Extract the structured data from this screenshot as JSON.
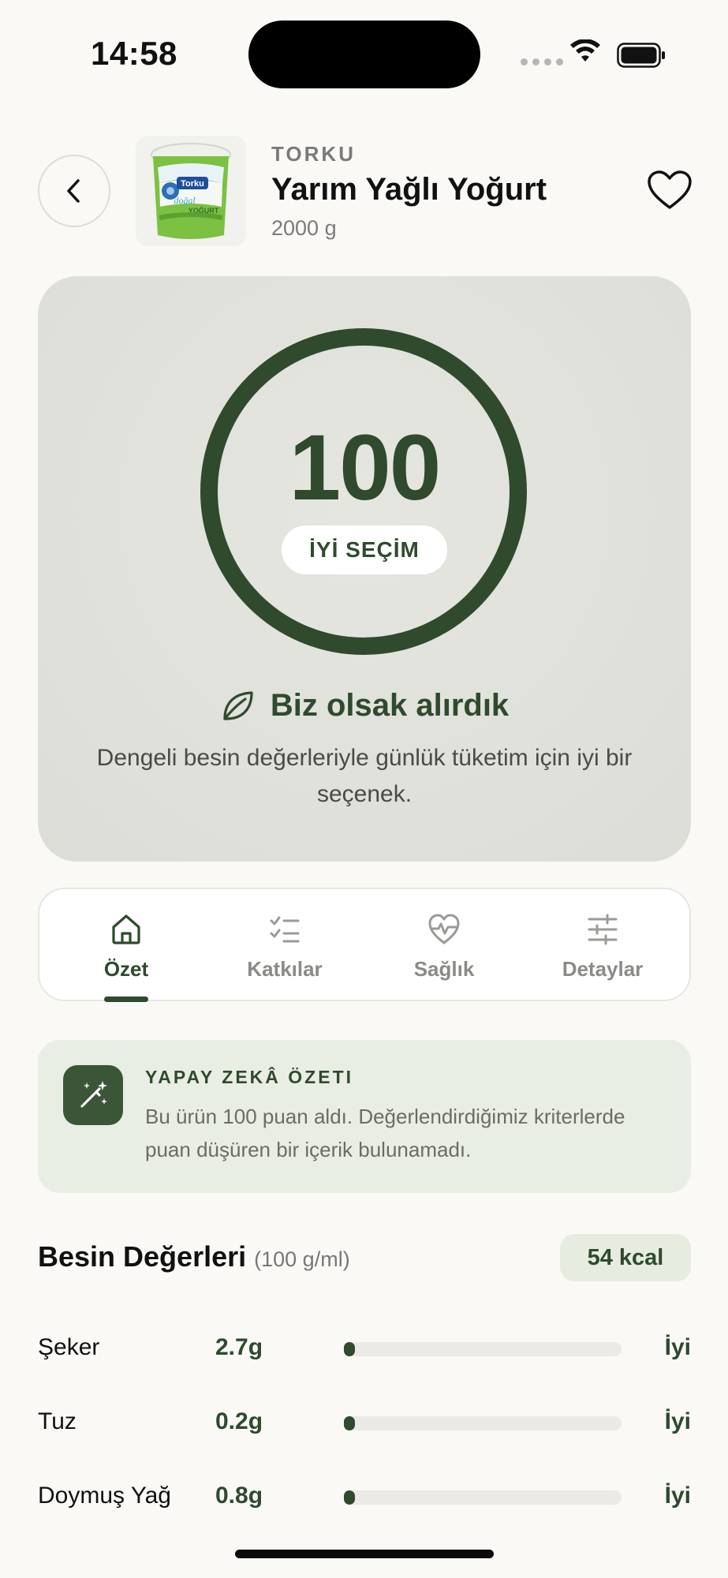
{
  "status_bar": {
    "time": "14:58"
  },
  "header": {
    "brand": "TORKU",
    "product_name": "Yarım Yağlı Yoğurt",
    "size": "2000 g",
    "thumb_text_brand": "Torku",
    "thumb_text_line1": "doğal",
    "thumb_text_line2": "YOĞURT"
  },
  "score": {
    "value": "100",
    "max": 100,
    "badge": "İYİ SEÇİM",
    "verdict_title": "Biz olsak alırdık",
    "verdict_description": "Dengeli besin değerleriyle günlük tüketim için iyi bir seçenek."
  },
  "tabs": [
    {
      "label": "Özet",
      "icon": "home-icon",
      "active": true
    },
    {
      "label": "Katkılar",
      "icon": "checklist-icon",
      "active": false
    },
    {
      "label": "Sağlık",
      "icon": "heart-pulse-icon",
      "active": false
    },
    {
      "label": "Detaylar",
      "icon": "sliders-icon",
      "active": false
    }
  ],
  "ai_summary": {
    "title": "YAPAY ZEKÂ ÖZETI",
    "text": "Bu ürün 100 puan aldı. Değerlendirdiğimiz kriterlerde puan düşüren bir içerik bulunamadı.",
    "icon": "magic-wand-icon"
  },
  "nutrition": {
    "title": "Besin Değerleri",
    "unit": "(100 g/ml)",
    "kcal": "54 kcal",
    "items": [
      {
        "name": "Şeker",
        "value": "2.7g",
        "level": 0.03,
        "status": "İyi"
      },
      {
        "name": "Tuz",
        "value": "0.2g",
        "level": 0.02,
        "status": "İyi"
      },
      {
        "name": "Doymuş Yağ",
        "value": "0.8g",
        "level": 0.03,
        "status": "İyi"
      }
    ]
  },
  "colors": {
    "accent": "#2f4a2d",
    "background": "#faf9f6",
    "card": "#e1e2dc",
    "ai_card": "#e9eee4"
  }
}
